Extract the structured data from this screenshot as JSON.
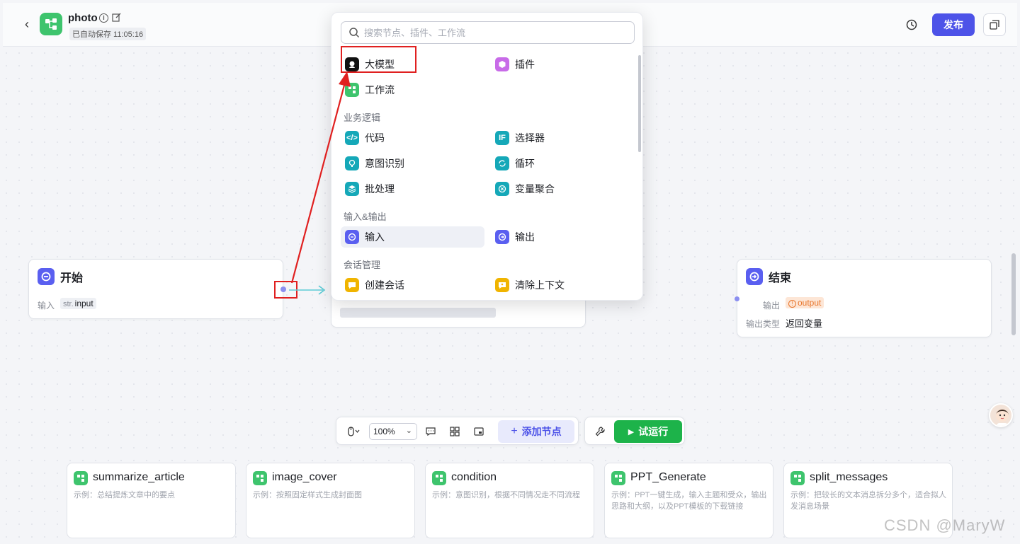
{
  "header": {
    "back_label": "‹",
    "app_title": "photo",
    "autosave": "已自动保存 11:05:16",
    "publish_label": "发布"
  },
  "nodes": {
    "start": {
      "title": "开始",
      "input_label": "输入",
      "input_type": "str.",
      "input_name": "input"
    },
    "end": {
      "title": "结束",
      "output_label": "输出",
      "output_tag": "output",
      "output_type_label": "输出类型",
      "output_type_value": "返回变量"
    }
  },
  "popup": {
    "search_placeholder": "搜索节点、插件、工作流",
    "top_items": [
      {
        "label": "大模型",
        "icon": "llm-icon",
        "color": "#111111"
      },
      {
        "label": "插件",
        "icon": "plugin-icon",
        "color": "#c86be8"
      },
      {
        "label": "工作流",
        "icon": "workflow-icon",
        "color": "#3ec46d"
      }
    ],
    "sections": [
      {
        "title": "业务逻辑",
        "items": [
          {
            "label": "代码",
            "icon": "code-icon",
            "color": "#15a8b8"
          },
          {
            "label": "选择器",
            "icon": "if-icon",
            "color": "#15a8b8"
          },
          {
            "label": "意图识别",
            "icon": "intent-icon",
            "color": "#15a8b8"
          },
          {
            "label": "循环",
            "icon": "loop-icon",
            "color": "#15a8b8"
          },
          {
            "label": "批处理",
            "icon": "batch-icon",
            "color": "#15a8b8"
          },
          {
            "label": "变量聚合",
            "icon": "aggregate-icon",
            "color": "#15a8b8"
          }
        ]
      },
      {
        "title": "输入&输出",
        "items": [
          {
            "label": "输入",
            "icon": "input-icon",
            "color": "#5a5ff0"
          },
          {
            "label": "输出",
            "icon": "output-icon",
            "color": "#5a5ff0"
          }
        ]
      },
      {
        "title": "会话管理",
        "items": [
          {
            "label": "创建会话",
            "icon": "create-chat-icon",
            "color": "#f0b400"
          },
          {
            "label": "清除上下文",
            "icon": "clear-context-icon",
            "color": "#f0b400"
          }
        ]
      }
    ]
  },
  "toolbar": {
    "zoom": "100%",
    "add_node_label": "添加节点",
    "run_label": "试运行"
  },
  "templates": [
    {
      "title": "summarize_article",
      "desc": "示例：总结提炼文章中的要点"
    },
    {
      "title": "image_cover",
      "desc": "示例：按照固定样式生成封面图"
    },
    {
      "title": "condition",
      "desc": "示例：意图识别，根据不同情况走不同流程"
    },
    {
      "title": "PPT_Generate",
      "desc": "示例：PPT一键生成，输入主题和受众，输出思路和大纲，以及PPT模板的下载链接"
    },
    {
      "title": "split_messages",
      "desc": "示例：把较长的文本消息拆分多个，适合拟人发消息场景"
    }
  ],
  "watermark": "CSDN @MaryW",
  "colors": {
    "accent": "#4d53e8",
    "run": "#1db34a",
    "annotation": "#e02020"
  }
}
